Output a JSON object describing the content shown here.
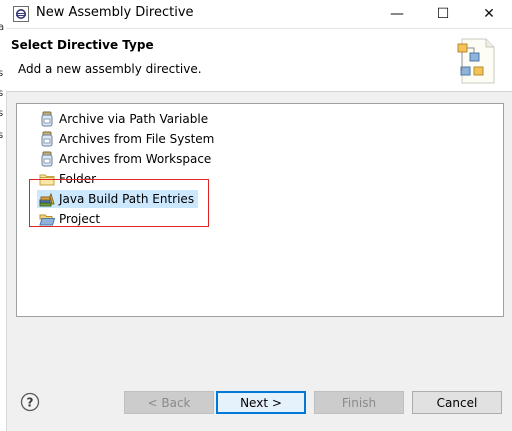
{
  "window": {
    "title": "New Assembly Directive",
    "controls": {
      "minimize": "—",
      "maximize": "☐",
      "close": "✕"
    }
  },
  "background_window": {
    "edge_letters": [
      "a",
      "s",
      "s",
      "s",
      "s"
    ]
  },
  "banner": {
    "title": "Select Directive Type",
    "description": "Add a new assembly directive.",
    "image_icon": "wizard-banner-icon"
  },
  "directive_list": {
    "items": [
      {
        "label": "Archive via Path Variable",
        "icon": "jar-icon",
        "selected": false
      },
      {
        "label": "Archives from File System",
        "icon": "jar-icon",
        "selected": false
      },
      {
        "label": "Archives from Workspace",
        "icon": "jar-icon",
        "selected": false
      },
      {
        "label": "Folder",
        "icon": "folder-icon",
        "selected": false
      },
      {
        "label": "Java Build Path Entries",
        "icon": "library-icon",
        "selected": true
      },
      {
        "label": "Project",
        "icon": "open-folder-icon",
        "selected": false
      }
    ]
  },
  "buttons": {
    "back": "< Back",
    "next": "Next >",
    "finish": "Finish",
    "cancel": "Cancel",
    "help_icon": "help-icon"
  },
  "colors": {
    "selection": "#cce8ff",
    "annotation_box": "#e02424",
    "default_button_border": "#0078d7"
  }
}
